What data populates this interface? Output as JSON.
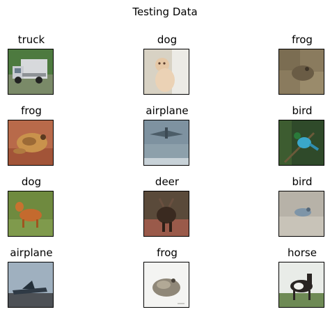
{
  "title": "Testing Data",
  "panels": [
    {
      "label": "truck"
    },
    {
      "label": "dog"
    },
    {
      "label": "frog"
    },
    {
      "label": "frog"
    },
    {
      "label": "airplane"
    },
    {
      "label": "bird"
    },
    {
      "label": "dog"
    },
    {
      "label": "deer"
    },
    {
      "label": "bird"
    },
    {
      "label": "airplane"
    },
    {
      "label": "frog"
    },
    {
      "label": "horse"
    }
  ]
}
